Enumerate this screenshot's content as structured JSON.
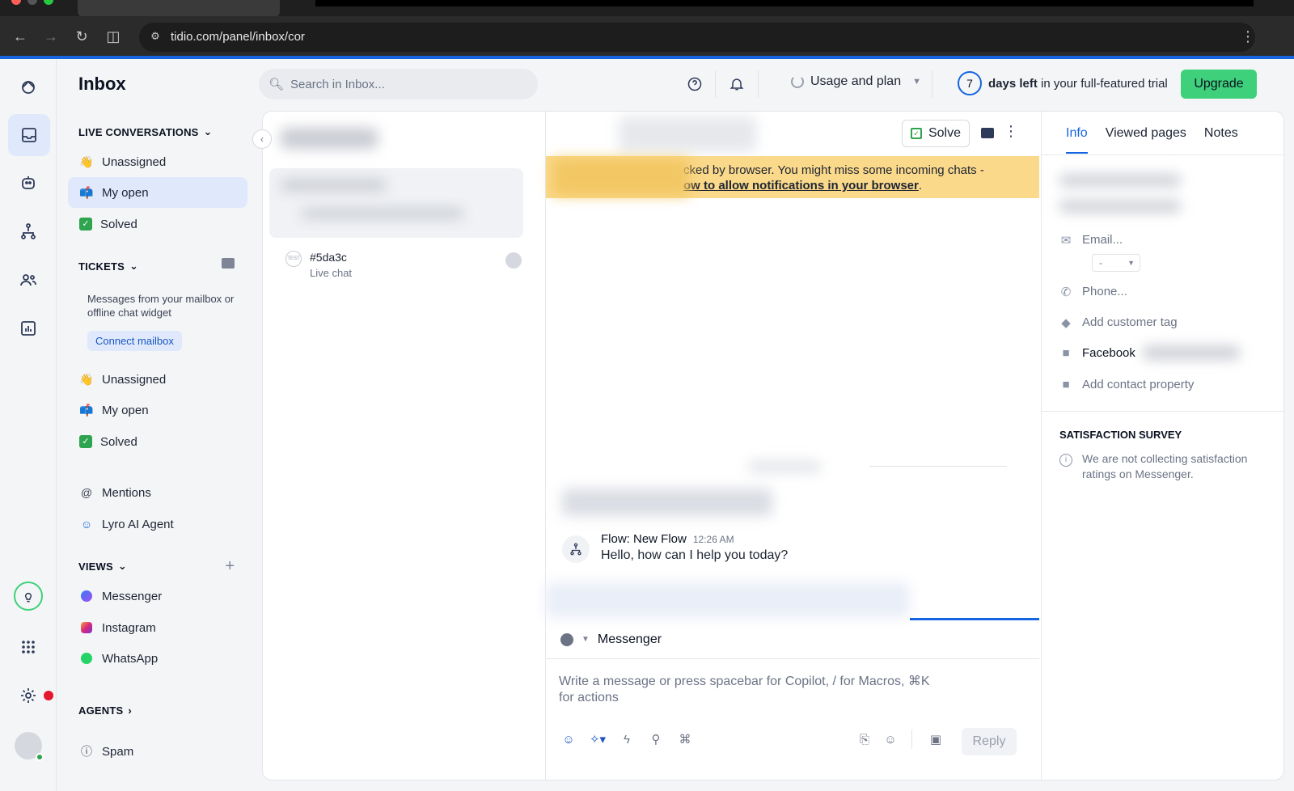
{
  "browser": {
    "url": "tidio.com/panel/inbox/cor"
  },
  "sidebar": {
    "title": "Inbox",
    "live_conversations": {
      "heading": "LIVE CONVERSATIONS",
      "items": [
        {
          "label": "Unassigned",
          "icon": "wave-emoji"
        },
        {
          "label": "My open",
          "icon": "mailbox-emoji",
          "active": true
        },
        {
          "label": "Solved",
          "icon": "check-emoji"
        }
      ]
    },
    "tickets": {
      "heading": "TICKETS",
      "description": "Messages from your mailbox or offline chat widget",
      "connect_label": "Connect mailbox",
      "items": [
        {
          "label": "Unassigned",
          "icon": "wave-emoji"
        },
        {
          "label": "My open",
          "icon": "mailbox-emoji"
        },
        {
          "label": "Solved",
          "icon": "check-emoji"
        }
      ]
    },
    "mentions_label": "Mentions",
    "lyro_label": "Lyro AI Agent",
    "views": {
      "heading": "VIEWS",
      "items": [
        {
          "label": "Messenger",
          "icon": "messenger-icon"
        },
        {
          "label": "Instagram",
          "icon": "instagram-icon"
        },
        {
          "label": "WhatsApp",
          "icon": "whatsapp-icon"
        }
      ]
    },
    "agents_heading": "AGENTS",
    "spam_label": "Spam"
  },
  "topbar": {
    "search_placeholder": "Search in Inbox...",
    "usage_label": "Usage and plan",
    "trial_days": "7",
    "trial_bold": "days left",
    "trial_rest": "in your full-featured trial",
    "upgrade_label": "Upgrade"
  },
  "conversation_list": {
    "item": {
      "avatar_text": "TEST",
      "id": "#5da3c",
      "channel": "Live chat"
    }
  },
  "chat": {
    "solve_label": "Solve",
    "banner_line1": "cked by browser. You might miss some incoming chats -",
    "banner_link": "ow to allow notifications in your browser",
    "banner_end": ".",
    "message": {
      "author": "Flow: New Flow",
      "time": "12:26 AM",
      "text": "Hello, how can I help you today?"
    },
    "channel_label": "Messenger",
    "compose_placeholder": "Write a message or press spacebar for Copilot, / for Macros, ⌘K for actions",
    "reply_label": "Reply"
  },
  "info_panel": {
    "tabs": [
      "Info",
      "Viewed pages",
      "Notes"
    ],
    "email_placeholder": "Email...",
    "select_value": "-",
    "phone_placeholder": "Phone...",
    "tag_label": "Add customer tag",
    "facebook_label": "Facebook",
    "property_label": "Add contact property",
    "satisfaction_heading": "SATISFACTION SURVEY",
    "satisfaction_text": "We are not collecting satisfaction ratings on Messenger."
  },
  "colors": {
    "accent": "#1565e0",
    "upgrade": "#3ed07a",
    "banner": "#fbd98a",
    "active_bg": "#dfe9fb"
  }
}
